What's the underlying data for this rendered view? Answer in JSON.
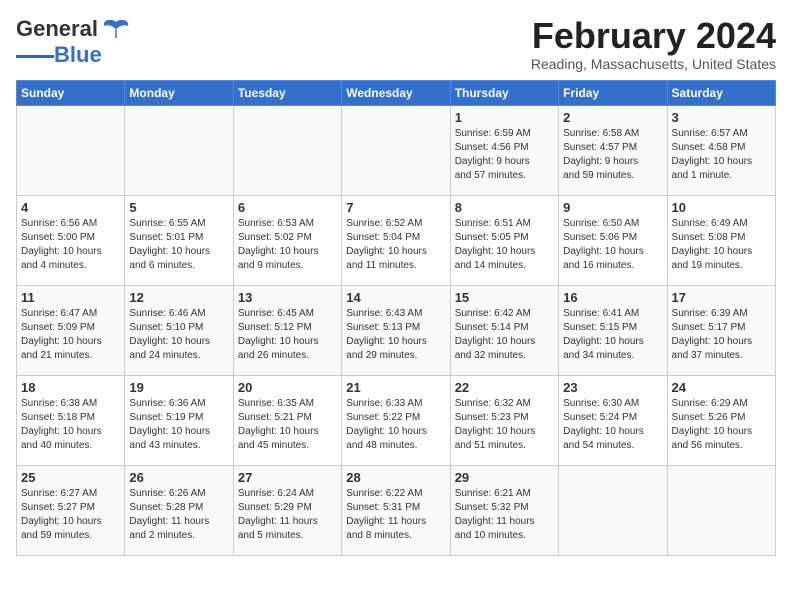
{
  "logo": {
    "general": "General",
    "blue": "Blue"
  },
  "title": "February 2024",
  "location": "Reading, Massachusetts, United States",
  "weekdays": [
    "Sunday",
    "Monday",
    "Tuesday",
    "Wednesday",
    "Thursday",
    "Friday",
    "Saturday"
  ],
  "weeks": [
    [
      {
        "day": "",
        "content": ""
      },
      {
        "day": "",
        "content": ""
      },
      {
        "day": "",
        "content": ""
      },
      {
        "day": "",
        "content": ""
      },
      {
        "day": "1",
        "content": "Sunrise: 6:59 AM\nSunset: 4:56 PM\nDaylight: 9 hours\nand 57 minutes."
      },
      {
        "day": "2",
        "content": "Sunrise: 6:58 AM\nSunset: 4:57 PM\nDaylight: 9 hours\nand 59 minutes."
      },
      {
        "day": "3",
        "content": "Sunrise: 6:57 AM\nSunset: 4:58 PM\nDaylight: 10 hours\nand 1 minute."
      }
    ],
    [
      {
        "day": "4",
        "content": "Sunrise: 6:56 AM\nSunset: 5:00 PM\nDaylight: 10 hours\nand 4 minutes."
      },
      {
        "day": "5",
        "content": "Sunrise: 6:55 AM\nSunset: 5:01 PM\nDaylight: 10 hours\nand 6 minutes."
      },
      {
        "day": "6",
        "content": "Sunrise: 6:53 AM\nSunset: 5:02 PM\nDaylight: 10 hours\nand 9 minutes."
      },
      {
        "day": "7",
        "content": "Sunrise: 6:52 AM\nSunset: 5:04 PM\nDaylight: 10 hours\nand 11 minutes."
      },
      {
        "day": "8",
        "content": "Sunrise: 6:51 AM\nSunset: 5:05 PM\nDaylight: 10 hours\nand 14 minutes."
      },
      {
        "day": "9",
        "content": "Sunrise: 6:50 AM\nSunset: 5:06 PM\nDaylight: 10 hours\nand 16 minutes."
      },
      {
        "day": "10",
        "content": "Sunrise: 6:49 AM\nSunset: 5:08 PM\nDaylight: 10 hours\nand 19 minutes."
      }
    ],
    [
      {
        "day": "11",
        "content": "Sunrise: 6:47 AM\nSunset: 5:09 PM\nDaylight: 10 hours\nand 21 minutes."
      },
      {
        "day": "12",
        "content": "Sunrise: 6:46 AM\nSunset: 5:10 PM\nDaylight: 10 hours\nand 24 minutes."
      },
      {
        "day": "13",
        "content": "Sunrise: 6:45 AM\nSunset: 5:12 PM\nDaylight: 10 hours\nand 26 minutes."
      },
      {
        "day": "14",
        "content": "Sunrise: 6:43 AM\nSunset: 5:13 PM\nDaylight: 10 hours\nand 29 minutes."
      },
      {
        "day": "15",
        "content": "Sunrise: 6:42 AM\nSunset: 5:14 PM\nDaylight: 10 hours\nand 32 minutes."
      },
      {
        "day": "16",
        "content": "Sunrise: 6:41 AM\nSunset: 5:15 PM\nDaylight: 10 hours\nand 34 minutes."
      },
      {
        "day": "17",
        "content": "Sunrise: 6:39 AM\nSunset: 5:17 PM\nDaylight: 10 hours\nand 37 minutes."
      }
    ],
    [
      {
        "day": "18",
        "content": "Sunrise: 6:38 AM\nSunset: 5:18 PM\nDaylight: 10 hours\nand 40 minutes."
      },
      {
        "day": "19",
        "content": "Sunrise: 6:36 AM\nSunset: 5:19 PM\nDaylight: 10 hours\nand 43 minutes."
      },
      {
        "day": "20",
        "content": "Sunrise: 6:35 AM\nSunset: 5:21 PM\nDaylight: 10 hours\nand 45 minutes."
      },
      {
        "day": "21",
        "content": "Sunrise: 6:33 AM\nSunset: 5:22 PM\nDaylight: 10 hours\nand 48 minutes."
      },
      {
        "day": "22",
        "content": "Sunrise: 6:32 AM\nSunset: 5:23 PM\nDaylight: 10 hours\nand 51 minutes."
      },
      {
        "day": "23",
        "content": "Sunrise: 6:30 AM\nSunset: 5:24 PM\nDaylight: 10 hours\nand 54 minutes."
      },
      {
        "day": "24",
        "content": "Sunrise: 6:29 AM\nSunset: 5:26 PM\nDaylight: 10 hours\nand 56 minutes."
      }
    ],
    [
      {
        "day": "25",
        "content": "Sunrise: 6:27 AM\nSunset: 5:27 PM\nDaylight: 10 hours\nand 59 minutes."
      },
      {
        "day": "26",
        "content": "Sunrise: 6:26 AM\nSunset: 5:28 PM\nDaylight: 11 hours\nand 2 minutes."
      },
      {
        "day": "27",
        "content": "Sunrise: 6:24 AM\nSunset: 5:29 PM\nDaylight: 11 hours\nand 5 minutes."
      },
      {
        "day": "28",
        "content": "Sunrise: 6:22 AM\nSunset: 5:31 PM\nDaylight: 11 hours\nand 8 minutes."
      },
      {
        "day": "29",
        "content": "Sunrise: 6:21 AM\nSunset: 5:32 PM\nDaylight: 11 hours\nand 10 minutes."
      },
      {
        "day": "",
        "content": ""
      },
      {
        "day": "",
        "content": ""
      }
    ]
  ]
}
